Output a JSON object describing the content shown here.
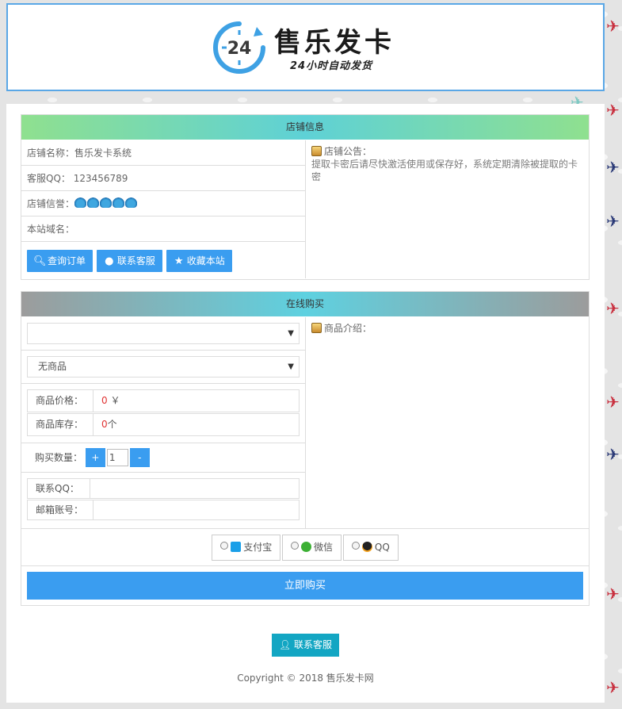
{
  "header": {
    "logo_badge": "24",
    "logo_title": "售乐发卡",
    "logo_subtitle": "24小时自动发货"
  },
  "shop_info": {
    "title": "店铺信息",
    "shop_name": "店铺名称：售乐发卡系统",
    "qq": "客服QQ：  123456789",
    "reputation_label": "店铺信誉：",
    "reputation_level": 5,
    "domain": "本站域名：",
    "buttons": {
      "query_order": "查询订单",
      "contact_service": "联系客服",
      "bookmark": "收藏本站"
    },
    "notice_title": "店铺公告：",
    "notice_text": "提取卡密后请尽快激活使用或保存好，系统定期清除被提取的卡密"
  },
  "purchase": {
    "title": "在线购买",
    "category_select": "",
    "product_select": "无商品",
    "price_label": "商品价格：",
    "price_value": "0",
    "price_unit": "￥",
    "stock_label": "商品库存：",
    "stock_value": "0",
    "stock_unit": "个",
    "qty_label": "购买数量：",
    "qty_plus": "+",
    "qty_value": "1",
    "qty_minus": "-",
    "contact_qq_label": "联系QQ：",
    "email_label": "邮箱账号：",
    "product_intro": "商品介绍：",
    "payment_methods": [
      "支付宝",
      "微信",
      "QQ"
    ],
    "buy_button": "立即购买"
  },
  "footer": {
    "contact_button": "联系客服",
    "copyright": "Copyright © 2018 售乐发卡网"
  },
  "colors": {
    "primary_blue": "#3a9df0",
    "cyan_button": "#13a6c3",
    "price_red": "#e03232"
  }
}
